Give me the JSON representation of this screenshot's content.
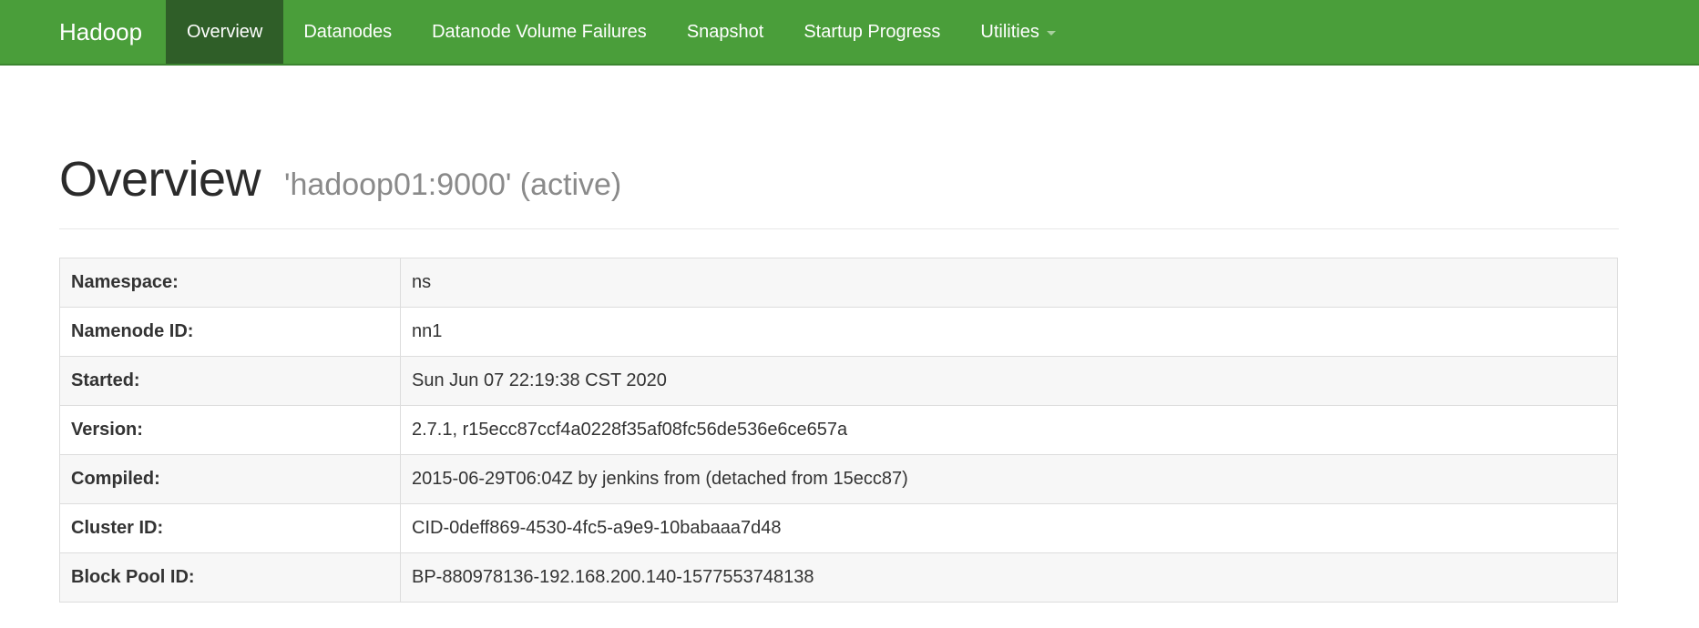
{
  "navbar": {
    "brand": "Hadoop",
    "items": [
      {
        "label": "Overview",
        "active": true
      },
      {
        "label": "Datanodes",
        "active": false
      },
      {
        "label": "Datanode Volume Failures",
        "active": false
      },
      {
        "label": "Snapshot",
        "active": false
      },
      {
        "label": "Startup Progress",
        "active": false
      },
      {
        "label": "Utilities",
        "active": false,
        "dropdown": true
      }
    ]
  },
  "header": {
    "title": "Overview",
    "subtitle": "'hadoop01:9000' (active)"
  },
  "info": {
    "rows": [
      {
        "label": "Namespace:",
        "value": "ns"
      },
      {
        "label": "Namenode ID:",
        "value": "nn1"
      },
      {
        "label": "Started:",
        "value": "Sun Jun 07 22:19:38 CST 2020"
      },
      {
        "label": "Version:",
        "value": "2.7.1, r15ecc87ccf4a0228f35af08fc56de536e6ce657a"
      },
      {
        "label": "Compiled:",
        "value": "2015-06-29T06:04Z by jenkins from (detached from 15ecc87)"
      },
      {
        "label": "Cluster ID:",
        "value": "CID-0deff869-4530-4fc5-a9e9-10babaaa7d48"
      },
      {
        "label": "Block Pool ID:",
        "value": "BP-880978136-192.168.200.140-1577553748138"
      }
    ]
  },
  "colors": {
    "navbar": "#4a9e3a",
    "navbar_active": "#2f5e28",
    "row_stripe": "#f7f7f7"
  }
}
